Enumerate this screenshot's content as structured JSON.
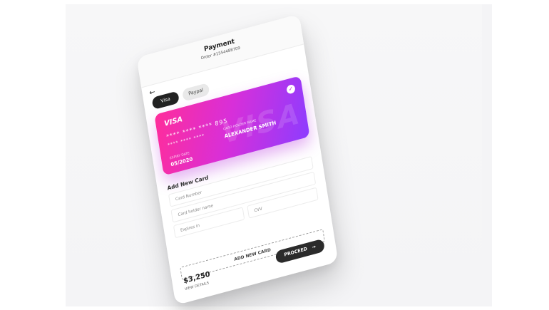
{
  "header": {
    "title": "Payment",
    "order": "Order #1554488709"
  },
  "payment_tabs": [
    {
      "label": "Visa"
    },
    {
      "label": "Paypal"
    }
  ],
  "card": {
    "brand": "VISA",
    "number_suffix": "**** **** **** 895",
    "masked_number": "**** **** ****",
    "expiry_label": "EXPIRY DATE",
    "expiry_value": "05/2020",
    "holder_label": "CARD HOLDER NAME",
    "holder_value": "ALEXANDER SMITH",
    "watermark": "VISA"
  },
  "add_new_card": {
    "title": "Add New Card",
    "card_number_placeholder": "Card Number",
    "holder_placeholder": "Card holder name",
    "expires_placeholder": "Expires in",
    "cvv_placeholder": "CVV",
    "add_button": "ADD NEW CARD"
  },
  "footer": {
    "price": "$3,250",
    "view_details": "VIEW DETAILS",
    "proceed": "PROCEED"
  },
  "icons": {
    "back": "arrow-left-icon",
    "check": "check-icon",
    "proceed_arrow": "arrow-right-icon"
  }
}
